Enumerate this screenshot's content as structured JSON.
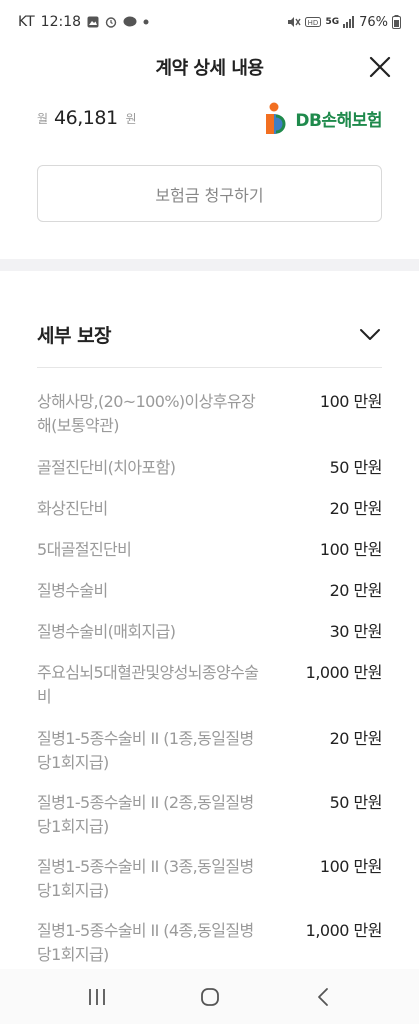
{
  "status_bar": {
    "carrier": "KT",
    "time": "12:18",
    "battery": "76%",
    "network": "5G"
  },
  "header": {
    "title": "계약 상세 내용"
  },
  "contract": {
    "currency_prefix": "월",
    "amount": "46,181",
    "currency_suffix": "원",
    "insurer": "DB손해보험"
  },
  "claim_button": {
    "label": "보험금 청구하기"
  },
  "coverage": {
    "title": "세부 보장",
    "items": [
      {
        "name": "상해사망,(20~100%)이상후유장해(보통약관)",
        "amount": "100 만원"
      },
      {
        "name": "골절진단비(치아포함)",
        "amount": "50 만원"
      },
      {
        "name": "화상진단비",
        "amount": "20 만원"
      },
      {
        "name": "5대골절진단비",
        "amount": "100 만원"
      },
      {
        "name": "질병수술비",
        "amount": "20 만원"
      },
      {
        "name": "질병수술비(매회지급)",
        "amount": "30 만원"
      },
      {
        "name": "주요심뇌5대혈관및양성뇌종양수술비",
        "amount": "1,000 만원"
      },
      {
        "name": "질병1-5종수술비 II (1종,동일질병당1회지급)",
        "amount": "20 만원"
      },
      {
        "name": "질병1-5종수술비 II (2종,동일질병당1회지급)",
        "amount": "50 만원"
      },
      {
        "name": "질병1-5종수술비 II (3종,동일질병당1회지급)",
        "amount": "100 만원"
      },
      {
        "name": "질병1-5종수술비 II (4종,동일질병당1회지급)",
        "amount": "1,000 만원"
      }
    ]
  },
  "colors": {
    "accent_green": "#1f8a4c",
    "logo_orange": "#f26f21",
    "logo_blue": "#2b7fd4",
    "muted_text": "#9a9a9a"
  },
  "icons": {
    "close": "close-icon",
    "chevron": "chevron-down-icon",
    "nav_recent": "recent-apps-icon",
    "nav_home": "home-icon",
    "nav_back": "back-icon"
  }
}
